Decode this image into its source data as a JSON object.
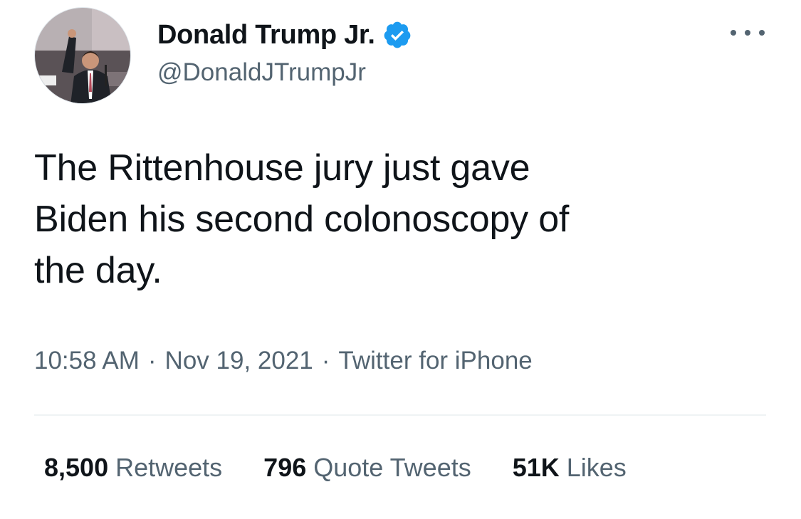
{
  "user": {
    "display_name": "Donald Trump Jr.",
    "handle": "@DonaldJTrumpJr",
    "avatar_icon": "profile-photo",
    "verified_icon": "verified-badge-icon",
    "verified_color": "#1d9bf0"
  },
  "tweet": {
    "text_lines": [
      "The Rittenhouse jury just gave",
      "Biden his second colonoscopy of",
      "the day."
    ],
    "time": "10:58 AM",
    "date": "Nov 19, 2021",
    "source": "Twitter for iPhone",
    "separator": "·"
  },
  "stats": {
    "retweets": {
      "count": "8,500",
      "label": "Retweets"
    },
    "quote_tweets": {
      "count": "796",
      "label": "Quote Tweets"
    },
    "likes": {
      "count": "51K",
      "label": "Likes"
    }
  },
  "colors": {
    "text_primary": "#0f1419",
    "text_secondary": "#536471",
    "divider": "#eff3f4"
  }
}
